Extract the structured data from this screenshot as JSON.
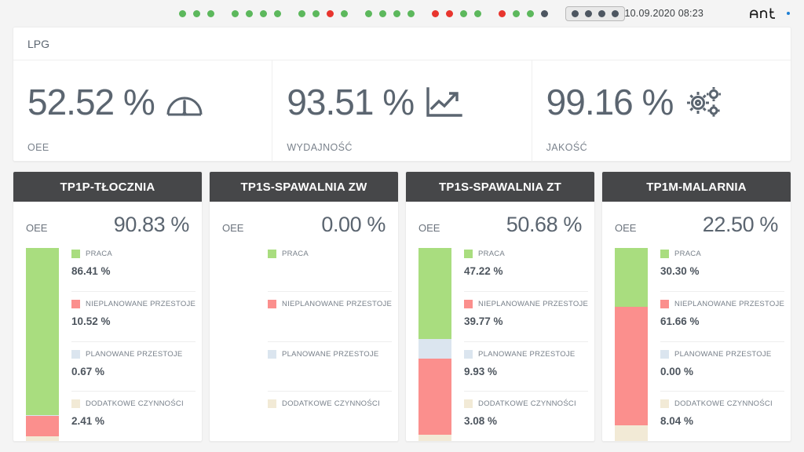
{
  "topbar": {
    "clock": "10.09.2020 08:23",
    "logo_text": "ant",
    "logo_dot_color": "#1e7fd4",
    "dot_colors": {
      "ok": "#5cb85c",
      "alarm": "#e8352e",
      "idle": "#4d5661"
    },
    "dot_groups": [
      {
        "name": "group-1",
        "dots": [
          "ok",
          "ok",
          "ok"
        ],
        "boxed": false
      },
      {
        "name": "group-2",
        "dots": [
          "ok",
          "ok",
          "ok",
          "ok"
        ],
        "boxed": false
      },
      {
        "name": "group-3",
        "dots": [
          "ok",
          "ok",
          "alarm",
          "ok"
        ],
        "boxed": false
      },
      {
        "name": "group-4",
        "dots": [
          "ok",
          "ok",
          "ok",
          "ok"
        ],
        "boxed": false
      },
      {
        "name": "group-5",
        "dots": [
          "alarm",
          "alarm",
          "ok",
          "ok"
        ],
        "boxed": false
      },
      {
        "name": "group-6",
        "dots": [
          "alarm",
          "ok",
          "ok",
          "idle"
        ],
        "boxed": false
      },
      {
        "name": "group-7",
        "dots": [
          "idle",
          "idle",
          "idle",
          "idle"
        ],
        "boxed": true
      }
    ]
  },
  "kpi": {
    "title": "LPG",
    "cells": [
      {
        "value": "52.52 %",
        "label": "OEE",
        "icon": "gauge-icon"
      },
      {
        "value": "93.51 %",
        "label": "WYDAJNOŚĆ",
        "icon": "trend-chart-icon"
      },
      {
        "value": "99.16 %",
        "label": "JAKOŚĆ",
        "icon": "gears-icon"
      }
    ]
  },
  "legend_colors": {
    "praca": "#a9dd7f",
    "nieplanowane": "#fb8f8d",
    "planowane": "#dbe5ef",
    "dodatkowe": "#f2ead6"
  },
  "cards": [
    {
      "title": "TP1P-TŁOCZNIA",
      "oee_label": "OEE",
      "oee_value": "90.83 %",
      "metrics": [
        {
          "label": "PRACA",
          "value": "86.41 %",
          "pct": 86.41,
          "color_key": "praca"
        },
        {
          "label": "NIEPLANOWANE PRZESTOJE",
          "value": "10.52 %",
          "pct": 10.52,
          "color_key": "nieplanowane"
        },
        {
          "label": "PLANOWANE PRZESTOJE",
          "value": "0.67 %",
          "pct": 0.67,
          "color_key": "planowane"
        },
        {
          "label": "DODATKOWE CZYNNOŚCI",
          "value": "2.41 %",
          "pct": 2.41,
          "color_key": "dodatkowe"
        }
      ],
      "bar_order": [
        "praca",
        "planowane",
        "nieplanowane",
        "dodatkowe"
      ]
    },
    {
      "title": "TP1S-SPAWALNIA ZW",
      "oee_label": "OEE",
      "oee_value": "0.00 %",
      "metrics": [
        {
          "label": "PRACA",
          "value": "",
          "pct": 0,
          "color_key": "praca"
        },
        {
          "label": "NIEPLANOWANE PRZESTOJE",
          "value": "",
          "pct": 0,
          "color_key": "nieplanowane"
        },
        {
          "label": "PLANOWANE PRZESTOJE",
          "value": "",
          "pct": 0,
          "color_key": "planowane"
        },
        {
          "label": "DODATKOWE CZYNNOŚCI",
          "value": "",
          "pct": 0,
          "color_key": "dodatkowe"
        }
      ],
      "bar_order": [
        "praca",
        "planowane",
        "nieplanowane",
        "dodatkowe"
      ]
    },
    {
      "title": "TP1S-SPAWALNIA ZT",
      "oee_label": "OEE",
      "oee_value": "50.68 %",
      "metrics": [
        {
          "label": "PRACA",
          "value": "47.22 %",
          "pct": 47.22,
          "color_key": "praca"
        },
        {
          "label": "NIEPLANOWANE PRZESTOJE",
          "value": "39.77 %",
          "pct": 39.77,
          "color_key": "nieplanowane"
        },
        {
          "label": "PLANOWANE PRZESTOJE",
          "value": "9.93 %",
          "pct": 9.93,
          "color_key": "planowane"
        },
        {
          "label": "DODATKOWE CZYNNOŚCI",
          "value": "3.08 %",
          "pct": 3.08,
          "color_key": "dodatkowe"
        }
      ],
      "bar_order": [
        "praca",
        "planowane",
        "nieplanowane",
        "dodatkowe"
      ]
    },
    {
      "title": "TP1M-MALARNIA",
      "oee_label": "OEE",
      "oee_value": "22.50 %",
      "metrics": [
        {
          "label": "PRACA",
          "value": "30.30 %",
          "pct": 30.3,
          "color_key": "praca"
        },
        {
          "label": "NIEPLANOWANE PRZESTOJE",
          "value": "61.66 %",
          "pct": 61.66,
          "color_key": "nieplanowane"
        },
        {
          "label": "PLANOWANE PRZESTOJE",
          "value": "0.00 %",
          "pct": 0.0,
          "color_key": "planowane"
        },
        {
          "label": "DODATKOWE CZYNNOŚCI",
          "value": "8.04 %",
          "pct": 8.04,
          "color_key": "dodatkowe"
        }
      ],
      "bar_order": [
        "praca",
        "planowane",
        "nieplanowane",
        "dodatkowe"
      ]
    }
  ],
  "chart_data": {
    "type": "bar",
    "title": "OEE breakdown per machine (stacked 100% vertical bars)",
    "categories": [
      "TP1P-TŁOCZNIA",
      "TP1S-SPAWALNIA ZW",
      "TP1S-SPAWALNIA ZT",
      "TP1M-MALARNIA"
    ],
    "series": [
      {
        "name": "PRACA",
        "values": [
          86.41,
          0,
          47.22,
          30.3
        ],
        "color": "#a9dd7f"
      },
      {
        "name": "PLANOWANE PRZESTOJE",
        "values": [
          0.67,
          0,
          9.93,
          0.0
        ],
        "color": "#dbe5ef"
      },
      {
        "name": "NIEPLANOWANE PRZESTOJE",
        "values": [
          10.52,
          0,
          39.77,
          61.66
        ],
        "color": "#fb8f8d"
      },
      {
        "name": "DODATKOWE CZYNNOŚCI",
        "values": [
          2.41,
          0,
          3.08,
          8.04
        ],
        "color": "#f2ead6"
      }
    ],
    "oee": [
      90.83,
      0.0,
      50.68,
      22.5
    ],
    "ylabel": "%",
    "ylim": [
      0,
      100
    ],
    "grid": false,
    "legend": "right-of-bar"
  }
}
